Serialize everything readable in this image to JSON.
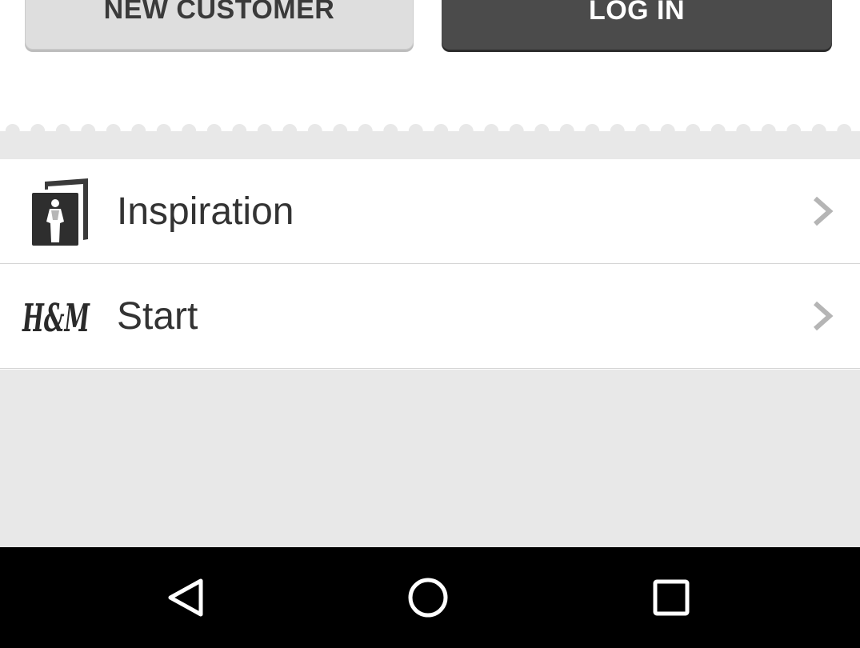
{
  "buttons": {
    "new_customer": "NEW CUSTOMER",
    "log_in": "LOG IN"
  },
  "menu": {
    "items": [
      {
        "label": "Inspiration",
        "icon": "inspiration-cards-icon"
      },
      {
        "label": "Start",
        "icon": "hm-logo-icon",
        "logo_text": "H&M"
      }
    ]
  },
  "navbar": {
    "back_icon": "back-triangle-icon",
    "home_icon": "home-circle-icon",
    "recent_icon": "recent-apps-square-icon"
  },
  "colors": {
    "login_button_bg": "#4b4b4b",
    "new_customer_bg": "#dedede",
    "panel_bg": "#e8e8e8",
    "navbar_bg": "#000000"
  }
}
